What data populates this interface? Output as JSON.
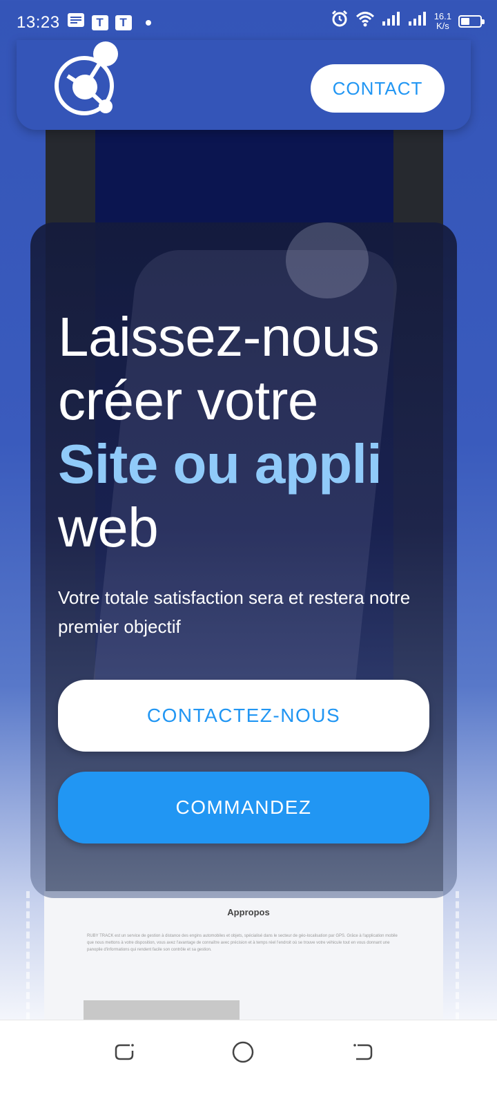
{
  "status_bar": {
    "time": "13:23",
    "notif_icons": [
      "notes-icon",
      "t-app-icon",
      "t-app-icon"
    ],
    "notif_t": "T",
    "speed_value": "16.1",
    "speed_unit": "K/s",
    "right_icons": [
      "alarm-icon",
      "wifi-icon",
      "signal-icon",
      "signal-icon",
      "battery-icon"
    ]
  },
  "header": {
    "logo": "site-logo",
    "contact_label": "CONTACT"
  },
  "hero": {
    "line1": "Laissez-nous",
    "line2": "créer votre",
    "accent": "Site ou appli",
    "line4": "web",
    "subtitle": "Votre totale satisfaction sera et restera notre premier objectif",
    "btn_contact": "CONTACTEZ-NOUS",
    "btn_order": "COMMANDEZ"
  },
  "background_mockup": {
    "section_title": "Appropos",
    "paragraph": "RUBY TRACK est un service de gestion à distance des engins automobiles et objets, spécialisé dans le secteur de géo-localisation par GPS. Grâce à l'application mobile que nous mettons à votre disposition, vous avez l'avantage de connaître avec précision et à temps réel l'endroit où se trouve votre véhicule tout en vous donnant une panoplie d'informations qui rendent facile son contrôle et sa gestion."
  },
  "nav_bar": {
    "buttons": [
      "recent-apps-icon",
      "home-icon",
      "back-icon"
    ]
  },
  "colors": {
    "brand_blue": "#3455b8",
    "accent_light_blue": "#90caf9",
    "button_blue": "#2196f3"
  }
}
